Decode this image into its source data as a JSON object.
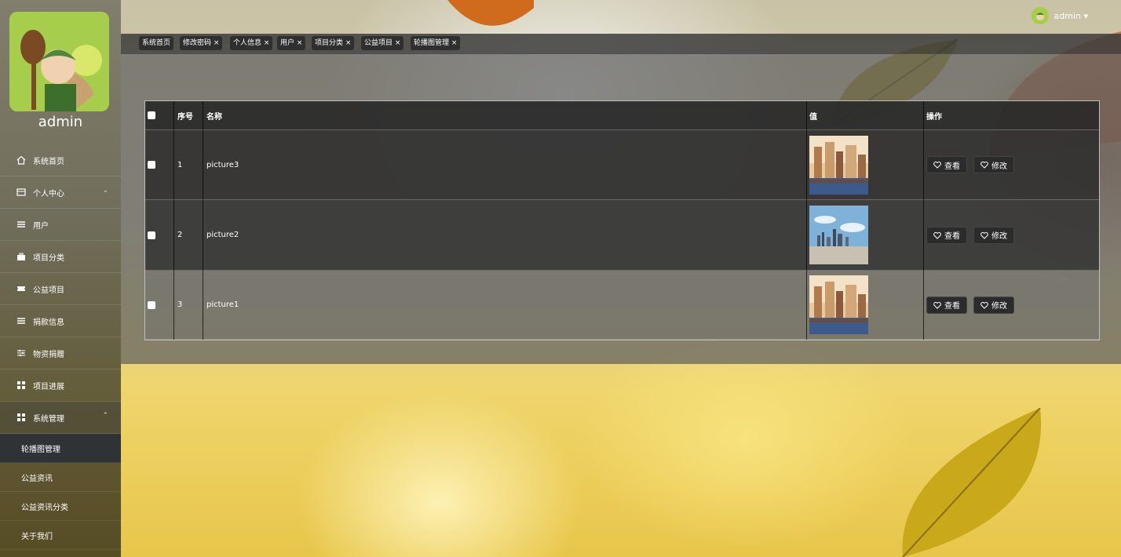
{
  "user": {
    "name": "admin",
    "menu_label": "admin ▾"
  },
  "sidebar": {
    "items": [
      {
        "label": "系统首页",
        "icon": "home-icon"
      },
      {
        "label": "个人中心",
        "icon": "card-icon",
        "chevron": "⌄"
      },
      {
        "label": "用户",
        "icon": "list-icon"
      },
      {
        "label": "项目分类",
        "icon": "briefcase-icon"
      },
      {
        "label": "公益项目",
        "icon": "ticket-icon"
      },
      {
        "label": "捐款信息",
        "icon": "list-icon"
      },
      {
        "label": "物资捐赠",
        "icon": "sliders-icon"
      },
      {
        "label": "项目进展",
        "icon": "grid-icon"
      },
      {
        "label": "系统管理",
        "icon": "grid-icon",
        "chevron": "⌃"
      }
    ],
    "sub_items": [
      {
        "label": "轮播图管理",
        "active": true
      },
      {
        "label": "公益资讯"
      },
      {
        "label": "公益资讯分类"
      },
      {
        "label": "关于我们"
      }
    ]
  },
  "tabs": [
    {
      "label": "系统首页"
    },
    {
      "label": "修改密码 ×"
    },
    {
      "label": "个人信息 ×"
    },
    {
      "label": "用户 ×"
    },
    {
      "label": "项目分类 ×"
    },
    {
      "label": "公益项目 ×"
    },
    {
      "label": "轮播图管理 ×"
    }
  ],
  "table": {
    "headers": {
      "index": "序号",
      "name": "名称",
      "value": "值",
      "actions": "操作"
    },
    "rows": [
      {
        "index": "1",
        "name": "picture3",
        "image": "city-harbor-image"
      },
      {
        "index": "2",
        "name": "picture2",
        "image": "city-skyline-image"
      },
      {
        "index": "3",
        "name": "picture1",
        "image": "city-harbor-image"
      }
    ],
    "view_label": "查看",
    "edit_label": "修改"
  },
  "colors": {
    "accent": "#2b2b2b",
    "avatar_bg": "#a6cd4b"
  }
}
